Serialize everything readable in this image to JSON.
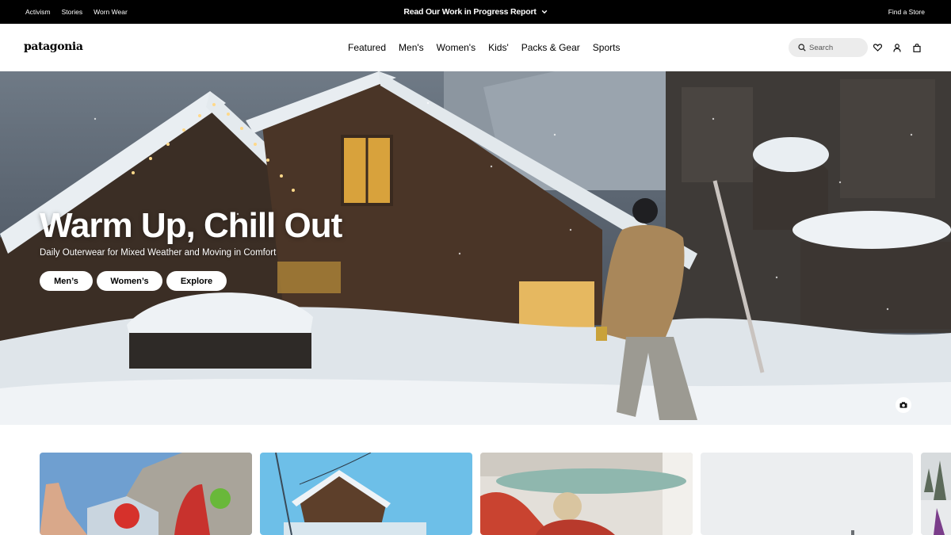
{
  "topbar": {
    "links": [
      "Activism",
      "Stories",
      "Worn Wear"
    ],
    "announcement": "Read Our Work in Progress Report",
    "find_store": "Find a Store"
  },
  "header": {
    "logo": "patagonia",
    "nav": [
      "Featured",
      "Men's",
      "Women's",
      "Kids'",
      "Packs & Gear",
      "Sports"
    ],
    "search_placeholder": "Search",
    "icons": [
      "heart-icon",
      "user-icon",
      "bag-icon"
    ]
  },
  "hero": {
    "title": "Warm Up, Chill Out",
    "subtitle": "Daily Outerwear for Mixed Weather and Moving in Comfort",
    "buttons": [
      "Men’s",
      "Women’s",
      "Explore"
    ],
    "camera_icon": "camera-icon"
  },
  "colors": {
    "topbar_bg": "#000000",
    "button_bg": "#ffffff",
    "search_bg": "#ececec"
  }
}
